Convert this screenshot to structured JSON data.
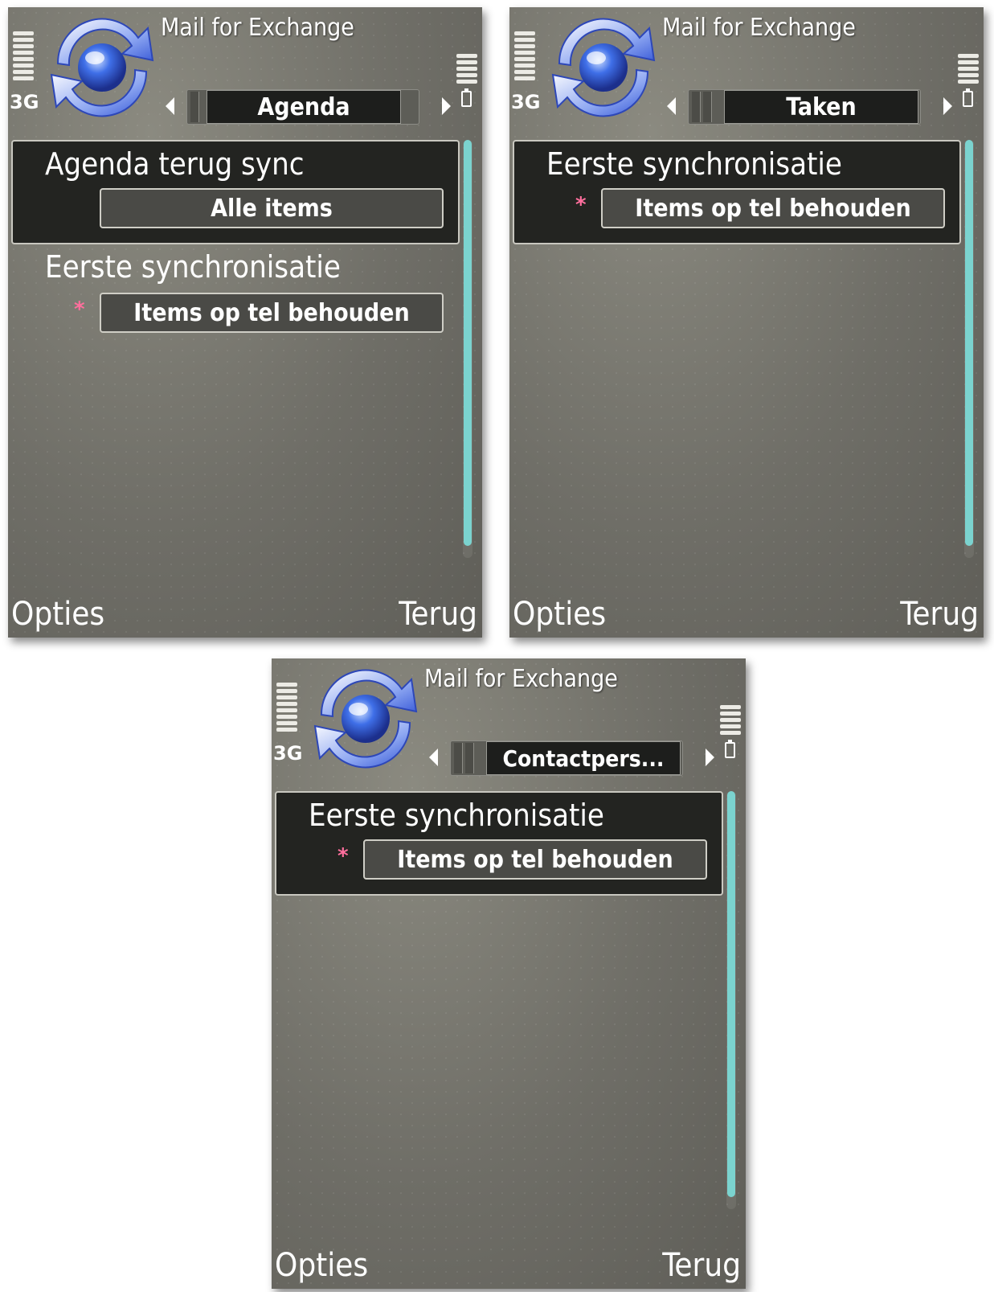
{
  "screens": [
    {
      "app_title": "Mail for Exchange",
      "network": "3G",
      "active_tab": "Agenda",
      "groups": [
        {
          "label": "Agenda terug sync",
          "value": "Alle items",
          "required": false
        },
        {
          "label": "Eerste synchronisatie",
          "value": "Items op tel behouden",
          "required": true
        }
      ],
      "softkeys": {
        "left": "Opties",
        "right": "Terug"
      }
    },
    {
      "app_title": "Mail for Exchange",
      "network": "3G",
      "active_tab": "Taken",
      "groups": [
        {
          "label": "Eerste synchronisatie",
          "value": "Items op tel behouden",
          "required": true
        }
      ],
      "softkeys": {
        "left": "Opties",
        "right": "Terug"
      }
    },
    {
      "app_title": "Mail for Exchange",
      "network": "3G",
      "active_tab": "Contactpers...",
      "groups": [
        {
          "label": "Eerste synchronisatie",
          "value": "Items op tel behouden",
          "required": true
        }
      ],
      "softkeys": {
        "left": "Opties",
        "right": "Terug"
      }
    }
  ],
  "required_marker": "*",
  "colors": {
    "accent_scroll": "#7bd3cf",
    "required": "#ff6f9d",
    "background": "#6f6e67"
  },
  "icons": [
    "sync-logo-icon",
    "signal-strength-icon",
    "battery-icon",
    "tab-left-arrow-icon",
    "tab-right-arrow-icon"
  ]
}
